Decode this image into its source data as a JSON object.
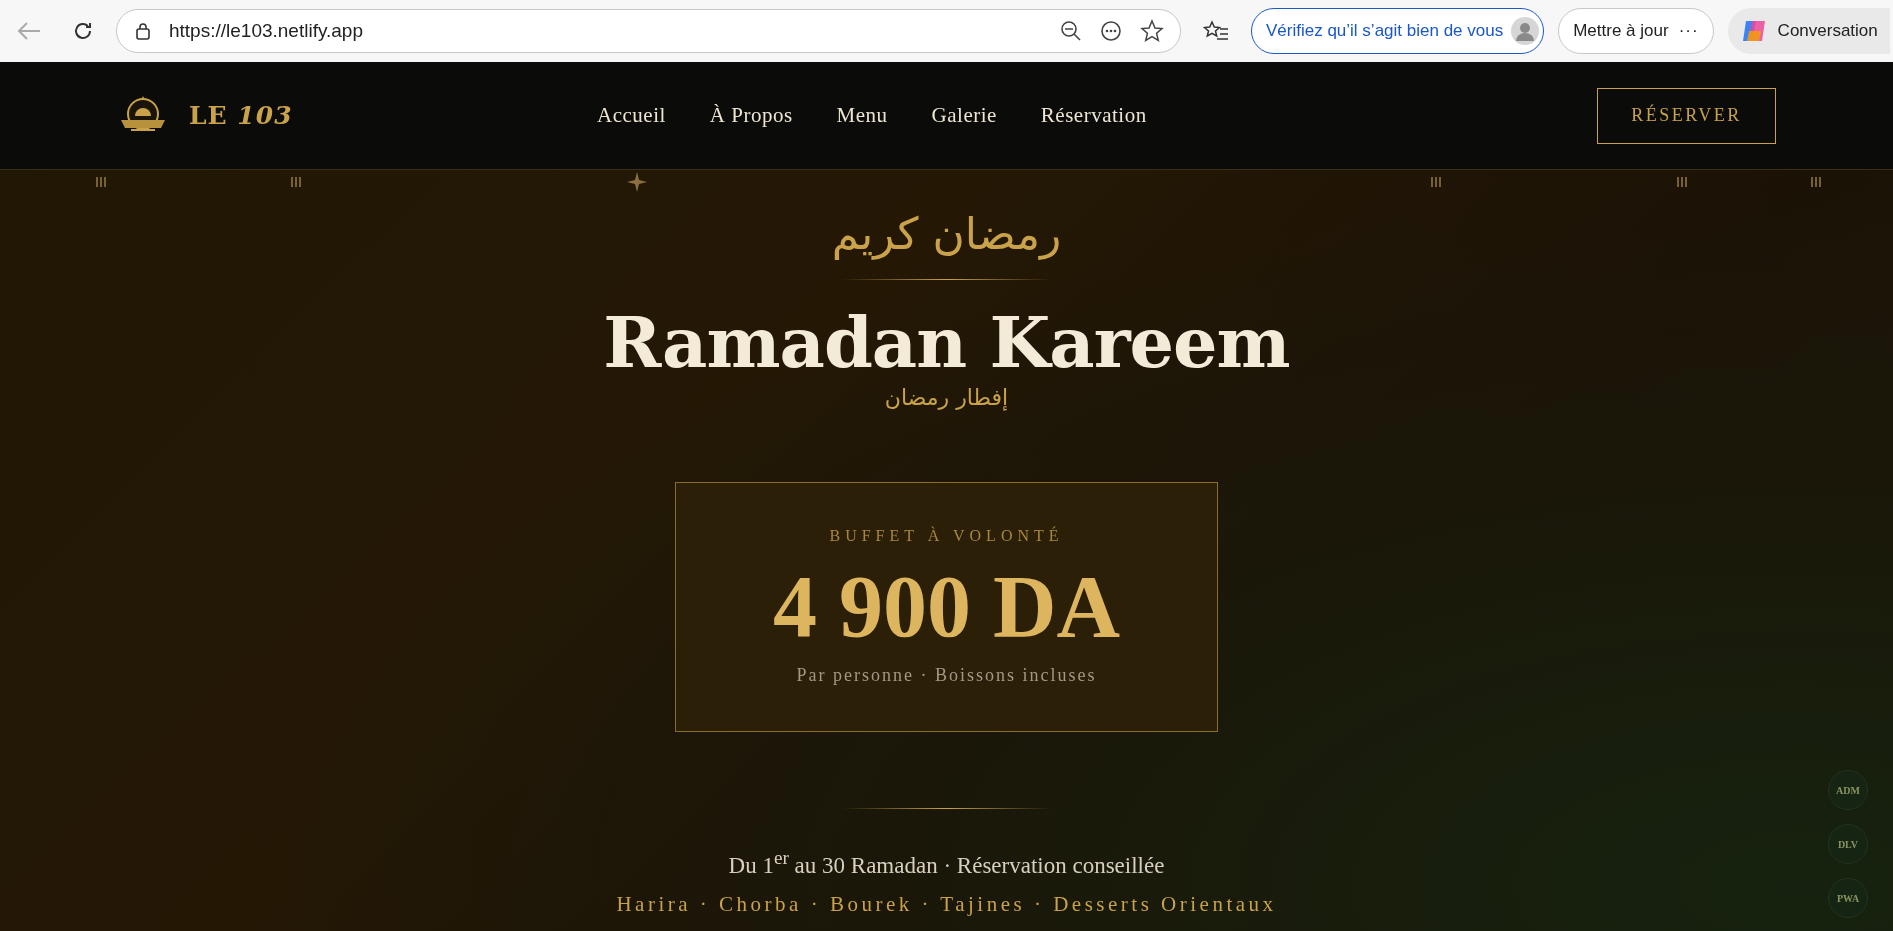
{
  "browser": {
    "url": "https://le103.netlify.app",
    "verify_label": "Vérifiez qu’il s’agit bien de vous",
    "update_label": "Mettre à jour",
    "update_more": "···",
    "copilot_label": "Conversation"
  },
  "nav": {
    "logo": "LE *103*",
    "links": [
      {
        "label": "Accueil"
      },
      {
        "label": "À Propos"
      },
      {
        "label": "Menu"
      },
      {
        "label": "Galerie"
      },
      {
        "label": "Réservation"
      }
    ],
    "cta": "RÉSERVER"
  },
  "hero": {
    "arabic_title": "رمضان كريم",
    "title": "Ramadan Kareem",
    "arabic_subtitle": "إفطار رمضان",
    "offer": {
      "label": "BUFFET À VOLONTÉ",
      "price": "4 900 DA",
      "note": "Par personne · Boissons incluses"
    },
    "dates": "Du 1$^{er}$ au 30 Ramadan · Réservation conseillée",
    "dishes": "Harira · Chorba · Bourek · Tajines · Desserts Orientaux"
  },
  "float_buttons": [
    {
      "label": "ADM"
    },
    {
      "label": "DLV"
    },
    {
      "label": "PWA"
    }
  ]
}
